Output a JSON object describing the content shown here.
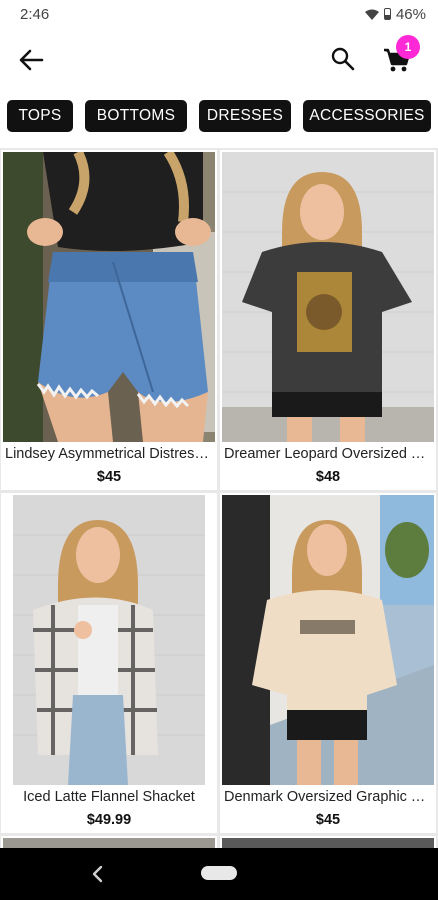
{
  "status": {
    "time": "2:46",
    "battery": "46%"
  },
  "header": {
    "cart_count": "1"
  },
  "categories": [
    "TOPS",
    "BOTTOMS",
    "DRESSES",
    "ACCESSORIES"
  ],
  "products": [
    {
      "name": "Lindsey Asymmetrical Distressed Shorts",
      "price": "$45"
    },
    {
      "name": "Dreamer Leopard Oversized Tee",
      "price": "$48"
    },
    {
      "name": "Iced Latte Flannel Shacket",
      "price": "$49.99"
    },
    {
      "name": "Denmark Oversized Graphic Tee",
      "price": "$45"
    }
  ],
  "colors": {
    "accent_badge": "#ff28d6",
    "chip_bg": "#111111"
  }
}
